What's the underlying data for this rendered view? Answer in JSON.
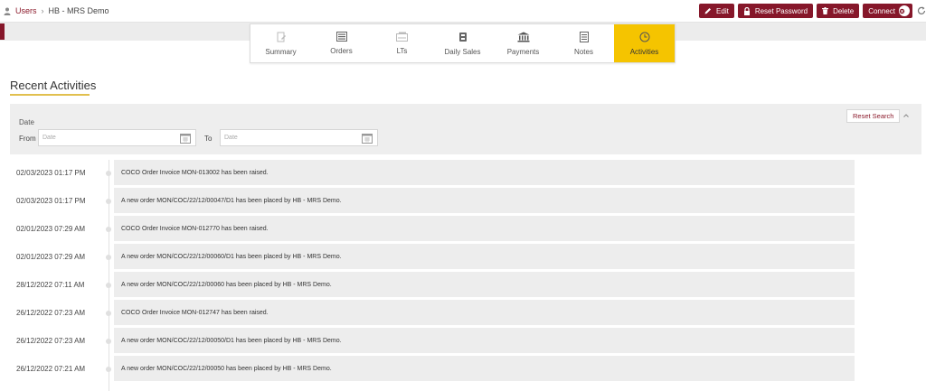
{
  "breadcrumb": {
    "root": "Users",
    "separator": "›",
    "current": "HB - MRS Demo"
  },
  "actions": {
    "edit": "Edit",
    "reset_password": "Reset Password",
    "delete": "Delete",
    "connect": "Connect"
  },
  "tabs": [
    {
      "label": "Summary",
      "icon": "summary-icon"
    },
    {
      "label": "Orders",
      "icon": "orders-icon"
    },
    {
      "label": "LTs",
      "icon": "lts-icon"
    },
    {
      "label": "Daily Sales",
      "icon": "daily-sales-icon"
    },
    {
      "label": "Payments",
      "icon": "bank-icon"
    },
    {
      "label": "Notes",
      "icon": "notes-icon"
    },
    {
      "label": "Activities",
      "icon": "clock-icon",
      "active": true
    }
  ],
  "heading": "Recent Activities",
  "filter": {
    "date_label": "Date",
    "from_label": "From",
    "to_label": "To",
    "from_placeholder": "Date",
    "to_placeholder": "Date",
    "reset_label": "Reset Search"
  },
  "activities": [
    {
      "time": "02/03/2023 01:17 PM",
      "text": "COCO Order Invoice MON-013002 has been raised."
    },
    {
      "time": "02/03/2023 01:17 PM",
      "text": "A new order MON/COC/22/12/00047/D1 has been placed by HB - MRS Demo."
    },
    {
      "time": "02/01/2023 07:29 AM",
      "text": "COCO Order Invoice MON-012770 has been raised."
    },
    {
      "time": "02/01/2023 07:29 AM",
      "text": "A new order MON/COC/22/12/00060/D1 has been placed by HB - MRS Demo."
    },
    {
      "time": "28/12/2022 07:11 AM",
      "text": "A new order MON/COC/22/12/00060 has been placed by HB - MRS Demo."
    },
    {
      "time": "26/12/2022 07:23 AM",
      "text": "COCO Order Invoice MON-012747 has been raised."
    },
    {
      "time": "26/12/2022 07:23 AM",
      "text": "A new order MON/COC/22/12/00050/D1 has been placed by HB - MRS Demo."
    },
    {
      "time": "26/12/2022 07:21 AM",
      "text": "A new order MON/COC/22/12/00050 has been placed by HB - MRS Demo."
    }
  ],
  "colors": {
    "brand": "#86172a",
    "active_tab": "#f5c400",
    "underline": "#e1c04f"
  }
}
